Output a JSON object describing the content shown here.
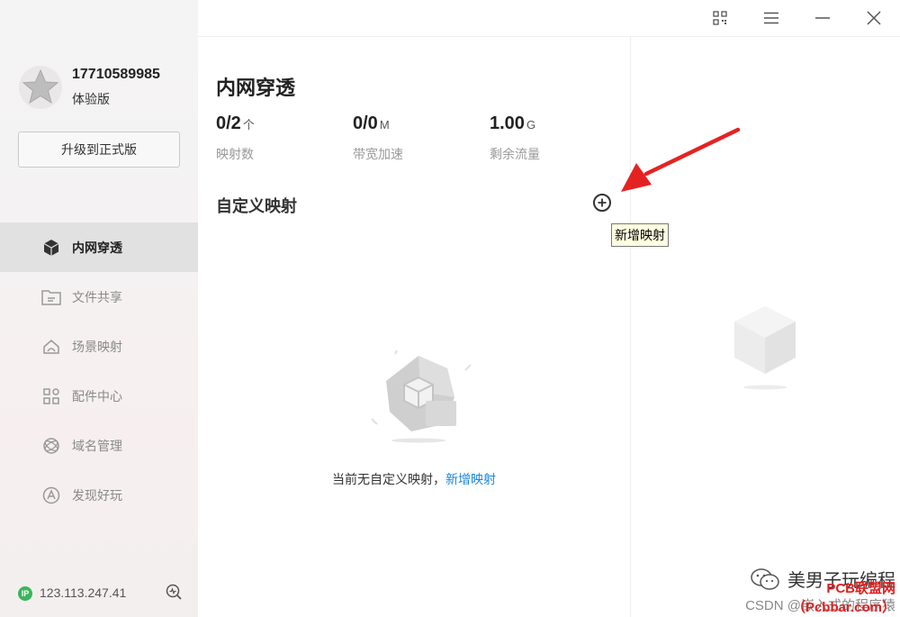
{
  "user": {
    "phone": "17710589985",
    "plan": "体验版",
    "upgrade_label": "升级到正式版"
  },
  "nav": {
    "items": [
      {
        "label": "内网穿透",
        "icon": "cube-icon",
        "active": true
      },
      {
        "label": "文件共享",
        "icon": "folder-share-icon",
        "active": false
      },
      {
        "label": "场景映射",
        "icon": "scene-map-icon",
        "active": false
      },
      {
        "label": "配件中心",
        "icon": "apps-grid-icon",
        "active": false
      },
      {
        "label": "域名管理",
        "icon": "domain-icon",
        "active": false
      },
      {
        "label": "发现好玩",
        "icon": "discover-icon",
        "active": false
      }
    ]
  },
  "footer": {
    "ip_badge": "IP",
    "ip_address": "123.113.247.41"
  },
  "topbar": {
    "icons": [
      "qr-code-icon",
      "menu-icon",
      "minimize-icon",
      "close-icon"
    ]
  },
  "main": {
    "title": "内网穿透",
    "stats": [
      {
        "value": "0/2",
        "unit": "个",
        "label": "映射数"
      },
      {
        "value": "0/0",
        "unit": "M",
        "label": "带宽加速"
      },
      {
        "value": "1.00",
        "unit": "G",
        "label": "剩余流量"
      }
    ],
    "section_title": "自定义映射",
    "add_tooltip": "新增映射",
    "empty_text": "当前无自定义映射，",
    "empty_link": "新增映射"
  },
  "watermark": {
    "line1": "美男子玩编程",
    "line2": "CSDN @嵌入式的程序猿",
    "line3": "PCB联盟网（Pcbbar.com）"
  },
  "colors": {
    "accent_link": "#1787e0",
    "arrow": "#e52222",
    "ip_badge": "#3bb55b"
  }
}
